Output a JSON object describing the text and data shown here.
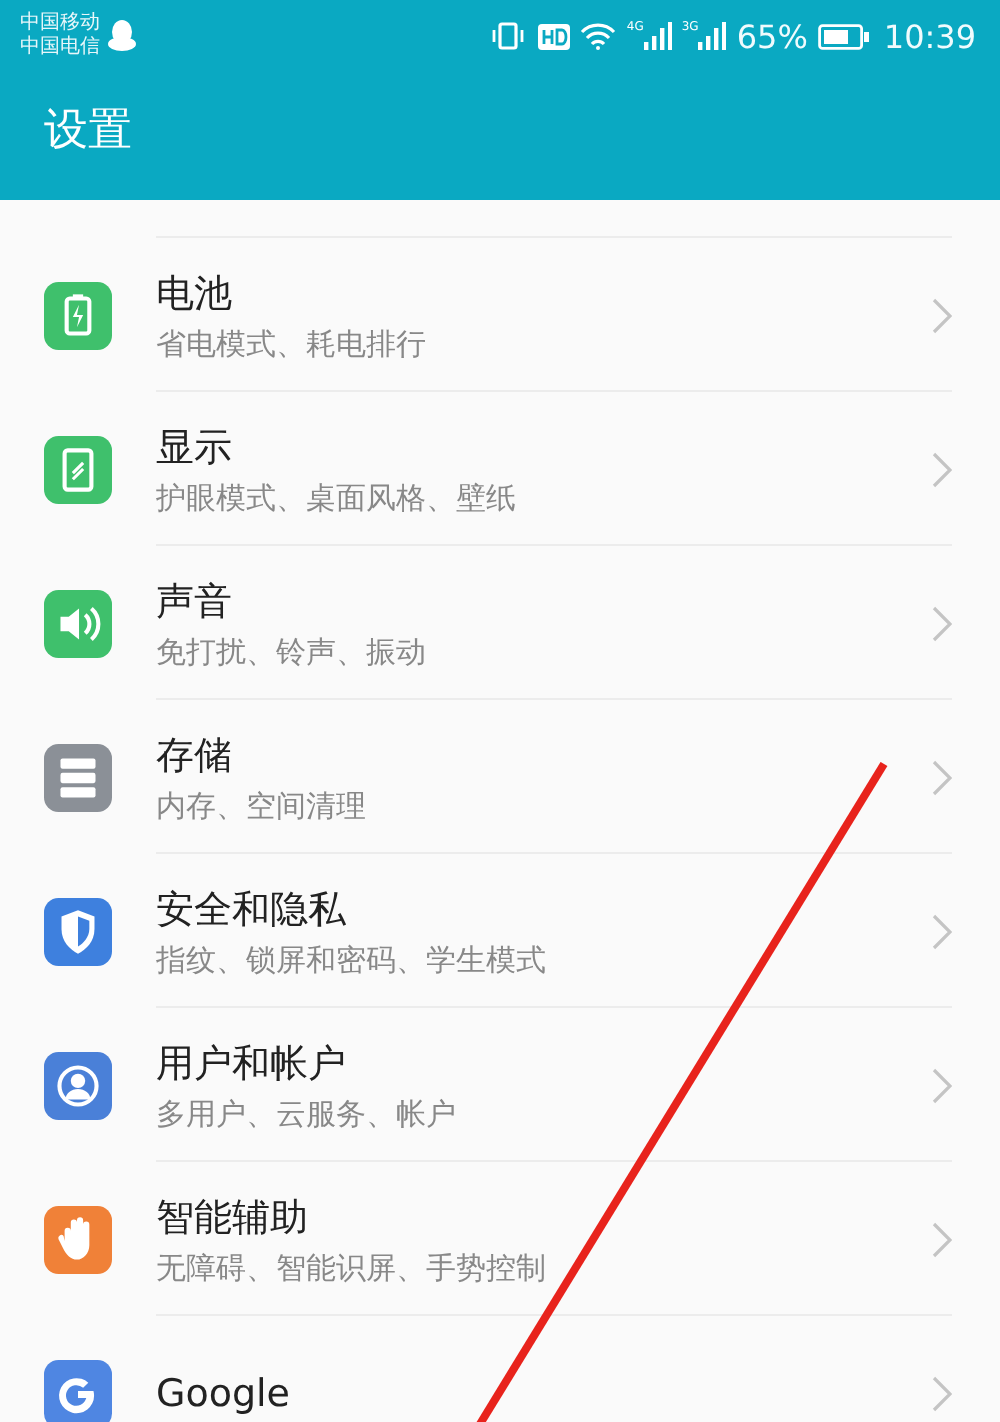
{
  "status_bar": {
    "carriers": [
      "中国移动",
      "中国电信"
    ],
    "networks": [
      {
        "label": "4G"
      },
      {
        "label": "3G"
      }
    ],
    "battery_text": "65%",
    "time": "10:39"
  },
  "app_bar": {
    "title": "设置"
  },
  "items": [
    {
      "kind": "battery",
      "title": "电池",
      "subtitle": "省电模式、耗电排行",
      "color": "#3fc06c"
    },
    {
      "kind": "display",
      "title": "显示",
      "subtitle": "护眼模式、桌面风格、壁纸",
      "color": "#3fc06c"
    },
    {
      "kind": "sound",
      "title": "声音",
      "subtitle": "免打扰、铃声、振动",
      "color": "#3fc06c"
    },
    {
      "kind": "storage",
      "title": "存储",
      "subtitle": "内存、空间清理",
      "color": "#8b9097"
    },
    {
      "kind": "security",
      "title": "安全和隐私",
      "subtitle": "指纹、锁屏和密码、学生模式",
      "color": "#3e80de"
    },
    {
      "kind": "users",
      "title": "用户和帐户",
      "subtitle": "多用户、云服务、帐户",
      "color": "#4a80d8"
    },
    {
      "kind": "assist",
      "title": "智能辅助",
      "subtitle": "无障碍、智能识屏、手势控制",
      "color": "#f08138"
    },
    {
      "kind": "google",
      "title": "Google",
      "color": "#4f86e2"
    }
  ]
}
